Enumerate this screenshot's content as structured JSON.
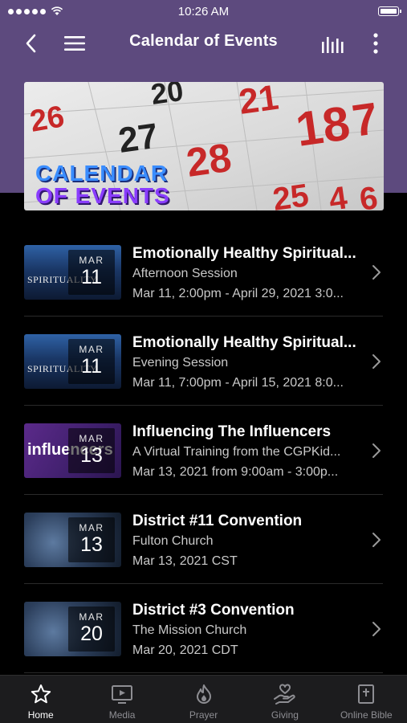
{
  "status_bar": {
    "time": "10:26 AM"
  },
  "nav": {
    "title": "Calendar of Events"
  },
  "banner": {
    "calendar_numbers": [
      "20",
      "21",
      "26",
      "27",
      "28",
      "18",
      "7",
      "25",
      "4",
      "6"
    ],
    "title_line1": "CALENDAR",
    "title_line2": "OF EVENTS"
  },
  "events": [
    {
      "month": "MAR",
      "day": "11",
      "thumb_text": "SPIRITUALITY",
      "title": "Emotionally Healthy Spiritual...",
      "subtitle": "Afternoon Session",
      "date": "Mar 11, 2:00pm - April 29, 2021 3:0..."
    },
    {
      "month": "MAR",
      "day": "11",
      "thumb_text": "SPIRITUALITY",
      "title": "Emotionally Healthy Spiritual...",
      "subtitle": "Evening Session",
      "date": "Mar 11, 7:00pm - April 15, 2021 8:0..."
    },
    {
      "month": "MAR",
      "day": "13",
      "thumb_text": "influencers",
      "title": "Influencing The Influencers",
      "subtitle": "A Virtual Training from the CGPKid...",
      "date": "Mar 13, 2021 from 9:00am - 3:00p..."
    },
    {
      "month": "MAR",
      "day": "13",
      "title": "District #11 Convention",
      "subtitle": "Fulton Church",
      "date": "Mar 13, 2021 CST"
    },
    {
      "month": "MAR",
      "day": "20",
      "title": "District #3 Convention",
      "subtitle": "The Mission Church",
      "date": "Mar 20, 2021 CDT"
    }
  ],
  "tabs": [
    {
      "label": "Home",
      "icon": "star-icon",
      "active": true
    },
    {
      "label": "Media",
      "icon": "tv-icon",
      "active": false
    },
    {
      "label": "Prayer",
      "icon": "flame-icon",
      "active": false
    },
    {
      "label": "Giving",
      "icon": "hand-heart-icon",
      "active": false
    },
    {
      "label": "Online Bible",
      "icon": "bible-icon",
      "active": false
    }
  ],
  "colors": {
    "header_bg": "#5d4a7e",
    "background": "#000000",
    "tab_bar_bg": "#1c1c1e",
    "tab_inactive": "#8e8e93"
  }
}
